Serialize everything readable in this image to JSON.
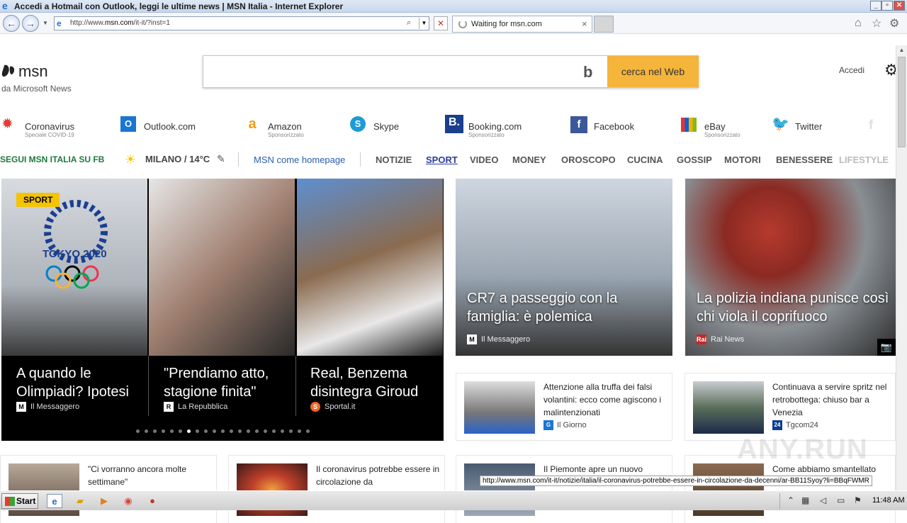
{
  "window": {
    "title": "Accedi a Hotmail con Outlook, leggi le ultime news | MSN Italia - Internet Explorer",
    "min_glyph": "_",
    "max_glyph": "▫",
    "close_glyph": "✕"
  },
  "browser": {
    "url_prefix": "http://www.",
    "url_domain": "msn.com",
    "url_suffix": "/it-it/?inst=1",
    "tab_label": "Waiting for msn.com",
    "tab_close": "×",
    "stop_glyph": "✕"
  },
  "header": {
    "logo_word": "msn",
    "logo_sub": "da Microsoft News",
    "search_placeholder": "",
    "bing_glyph": "b",
    "search_button": "cerca nel Web",
    "signin": "Accedi",
    "settings_glyph": "⚙"
  },
  "quicklinks": [
    {
      "name": "Coronavirus",
      "sub": "Speciale COVID-19",
      "icon": "virus-icon",
      "color": "#e53935"
    },
    {
      "name": "Outlook.com",
      "sub": "",
      "icon": "outlook-icon",
      "color": "#1976d2"
    },
    {
      "name": "Amazon",
      "sub": "Sponsorizzato",
      "icon": "amazon-icon",
      "color": "#f39c12"
    },
    {
      "name": "Skype",
      "sub": "",
      "icon": "skype-icon",
      "color": "#1e9bd7"
    },
    {
      "name": "Booking.com",
      "sub": "Sponsorizzato",
      "icon": "booking-icon",
      "color": "#1a3f8f"
    },
    {
      "name": "Facebook",
      "sub": "",
      "icon": "facebook-icon",
      "color": "#3b5998"
    },
    {
      "name": "eBay",
      "sub": "Sponsorizzato",
      "icon": "ebay-icon",
      "color": "#e53238"
    },
    {
      "name": "Twitter",
      "sub": "",
      "icon": "twitter-icon",
      "color": "#1da1f2"
    }
  ],
  "navrow": {
    "segui": "SEGUI MSN ITALIA SU FB",
    "weather": "MILANO / 14°C",
    "edit_glyph": "✎",
    "home": "MSN come homepage",
    "items": [
      "NOTIZIE",
      "SPORT",
      "VIDEO",
      "MONEY",
      "OROSCOPO",
      "CUCINA",
      "GOSSIP",
      "MOTORI",
      "BENESSERE",
      "LIFESTYLE"
    ],
    "active": "SPORT"
  },
  "hero": {
    "badge": "SPORT",
    "slides": [
      {
        "caption": "A quando le Olimpiadi? Ipotesi",
        "source": "Il Messaggero",
        "logo": "M"
      },
      {
        "caption": "\"Prendiamo atto, stagione finita\"",
        "source": "La Repubblica",
        "logo": "R"
      },
      {
        "caption": "Real, Benzema disintegra Giroud",
        "source": "Sportal.it",
        "logo": "S"
      }
    ],
    "dot_count": 21,
    "active_dot": 6
  },
  "big_cards": [
    {
      "caption": "CR7 a passeggio con la famiglia: è polemica",
      "source": "Il Messaggero",
      "logo": "M"
    },
    {
      "caption": "La polizia indiana punisce così chi viola il coprifuoco",
      "source": "Rai News",
      "logo": "Rai",
      "camera_glyph": "📷"
    }
  ],
  "small_cards": [
    {
      "text": "Attenzione alla truffa dei falsi volantini: ecco come agiscono i malintenzionati",
      "source": "Il Giorno",
      "logo": "G"
    },
    {
      "text": "Continuava a servire spritz nel retrobottega: chiuso bar a Venezia",
      "source": "Tgcom24",
      "logo": "24"
    },
    {
      "text": "\"Ci vorranno ancora molte settimane\"",
      "source": "",
      "logo": ""
    },
    {
      "text": "Il coronavirus potrebbe essere in circolazione da",
      "source": "",
      "logo": ""
    },
    {
      "text": "Il Piemonte apre un nuovo",
      "source": "",
      "logo": ""
    },
    {
      "text": "Come abbiamo smantellato",
      "source": "",
      "logo": ""
    }
  ],
  "status_url": "http://www.msn.com/it-it/notizie/italia/il-coronavirus-potrebbe-essere-in-circolazione-da-decenni/ar-BB11Syoy?li=BBqFWMR",
  "taskbar": {
    "start": "Start",
    "clock": "11:48 AM"
  }
}
